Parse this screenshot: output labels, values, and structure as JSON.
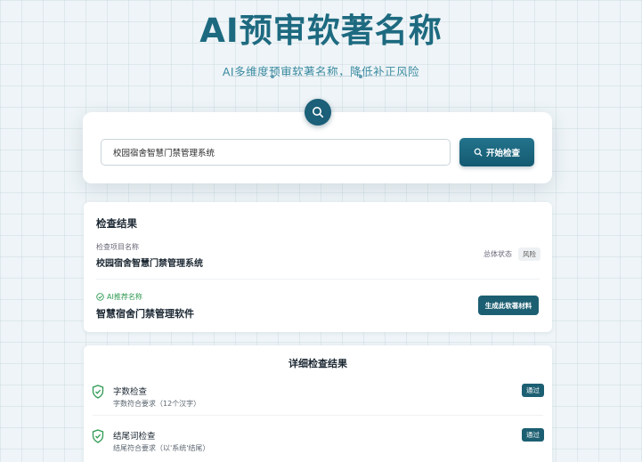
{
  "hero": {
    "title": "AI预审软著名称",
    "subtitle": "AI多维度预审软著名称，降低补正风险"
  },
  "search": {
    "value": "校园宿舍智慧门禁管理系统",
    "button_label": "开始检查",
    "icon": "search-icon"
  },
  "result": {
    "title": "检查结果",
    "project_label": "检查项目名称",
    "project_name": "校园宿舍智慧门禁管理系统",
    "status_label": "总体状态",
    "status_value": "风险",
    "ai_label": "AI推荐名称",
    "ai_name": "智慧宿舍门禁管理软件",
    "generate_label": "生成此软著材料"
  },
  "details": {
    "title": "详细检查结果",
    "items": [
      {
        "name": "字数检查",
        "desc": "字数符合要求（12个汉字）",
        "status": "通过"
      },
      {
        "name": "结尾词检查",
        "desc": "结尾符合要求（以'系统'结尾）",
        "status": "通过"
      }
    ]
  },
  "colors": {
    "brand": "#1d6a80",
    "button": "#1b5f78",
    "success": "#2f9a53"
  }
}
